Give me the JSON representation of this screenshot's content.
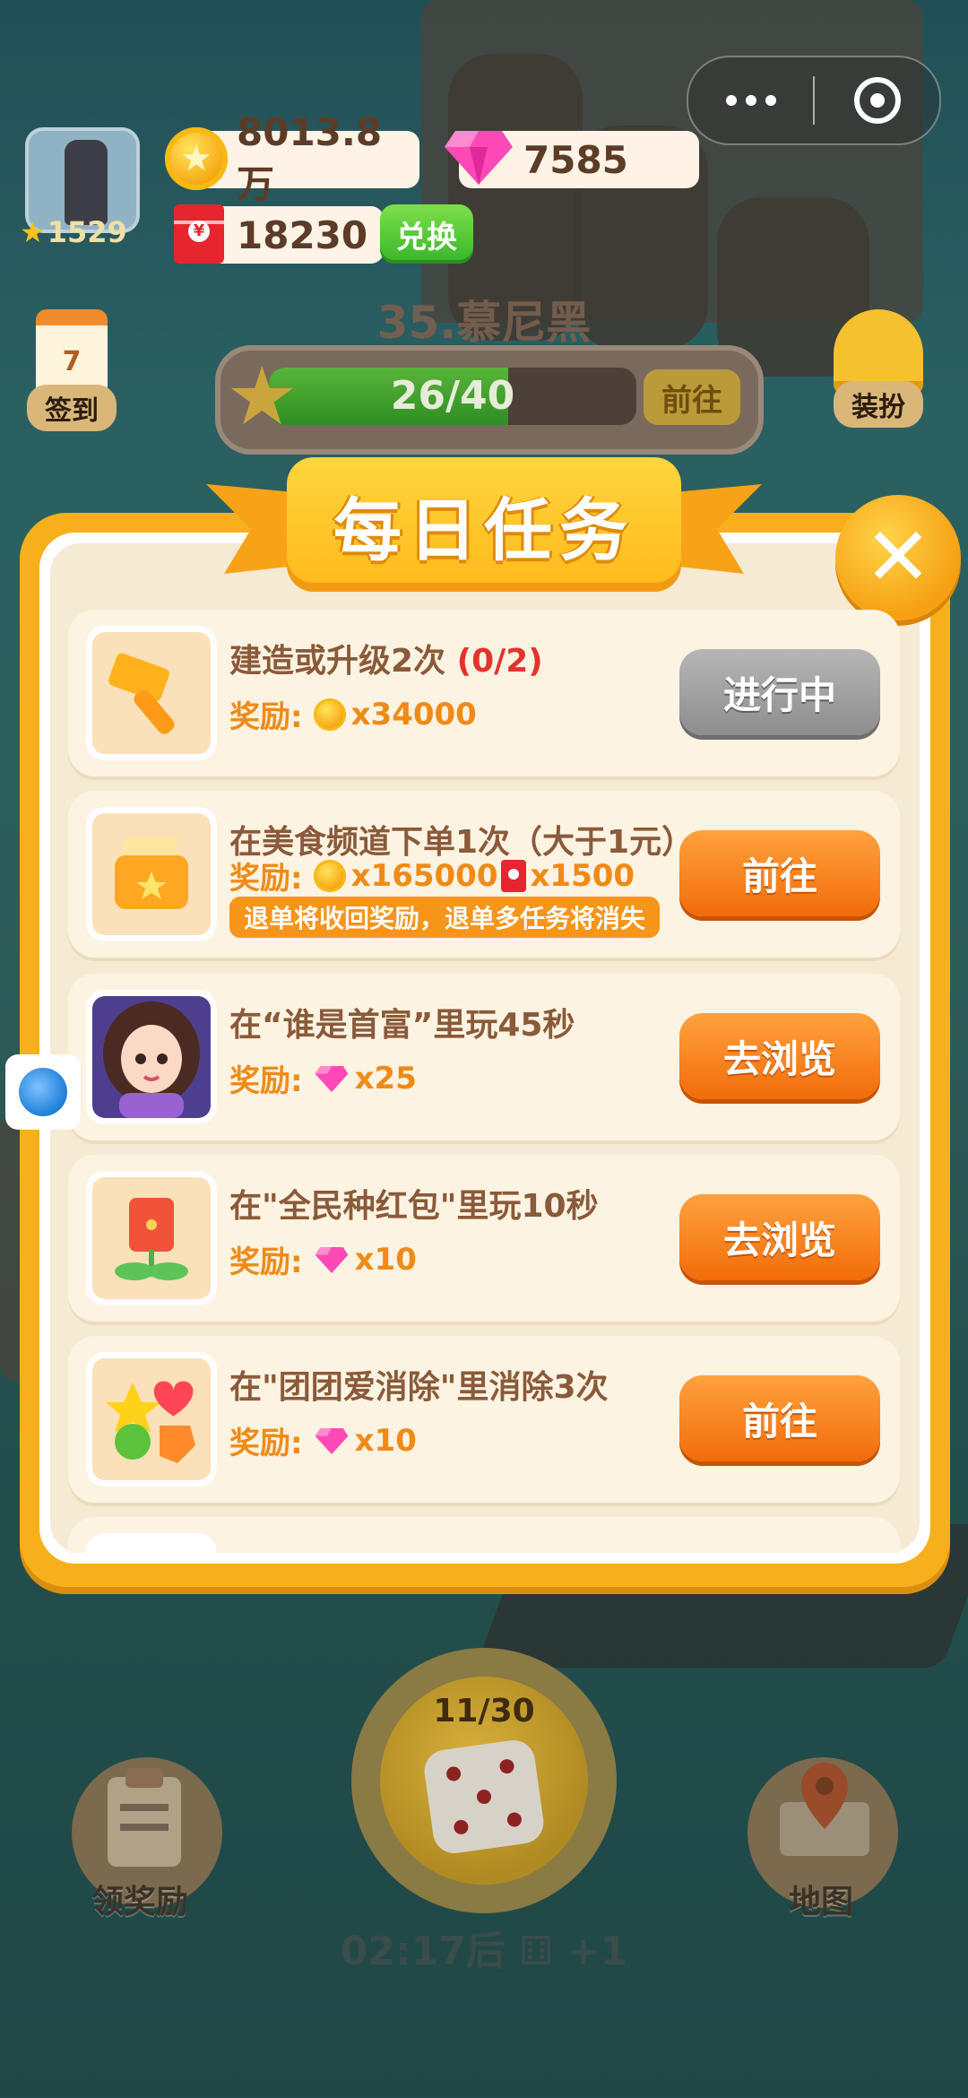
{
  "hud": {
    "avatar_level": "1529",
    "coins": "8013.8万",
    "gems": "7585",
    "red_packets": "18230",
    "exchange_label": "兑换",
    "sign_in": {
      "day": "7",
      "label": "签到"
    },
    "dress_up_label": "装扮",
    "city_title": "35.慕尼黑",
    "progress_text": "26/40",
    "progress_ratio": 0.65,
    "goto_label": "前往"
  },
  "modal": {
    "title": "每日任务",
    "tasks": [
      {
        "title": "建造或升级2次",
        "progress": "(0/2)",
        "reward_label": "奖励:",
        "reward_coin": "x34000",
        "button": "进行中",
        "button_style": "gray",
        "icon": "hammer-icon"
      },
      {
        "title": "在美食频道下单1次（大于1元）",
        "reward_label": "奖励:",
        "reward_coin": "x165000",
        "reward_redpacket": "x1500",
        "warning": "退单将收回奖励，退单多任务将消失",
        "button": "前往",
        "button_style": "orange",
        "icon": "food-bag-icon"
      },
      {
        "title": "在“谁是首富”里玩45秒",
        "reward_label": "奖励:",
        "reward_gem": "x25",
        "button": "去浏览",
        "button_style": "orange",
        "icon": "girl-avatar-icon"
      },
      {
        "title": "在\"全民种红包\"里玩10秒",
        "reward_label": "奖励:",
        "reward_gem": "x10",
        "button": "去浏览",
        "button_style": "orange",
        "icon": "red-packet-flower-icon"
      },
      {
        "title": "在\"团团爱消除\"里消除3次",
        "reward_label": "奖励:",
        "reward_gem": "x10",
        "button": "前往",
        "button_style": "orange",
        "icon": "fruit-match-icon"
      }
    ]
  },
  "bottom": {
    "dice_count": "11/30",
    "timer_text": "02:17后",
    "timer_bonus": "+1",
    "claim_label": "领奖励",
    "map_label": "地图"
  },
  "colors": {
    "modal_frame": "#f7b01b",
    "button_orange": "#f26b0a",
    "button_gray": "#8d8d8d",
    "reward_text": "#f08a17",
    "progress_red": "#e4332f"
  }
}
